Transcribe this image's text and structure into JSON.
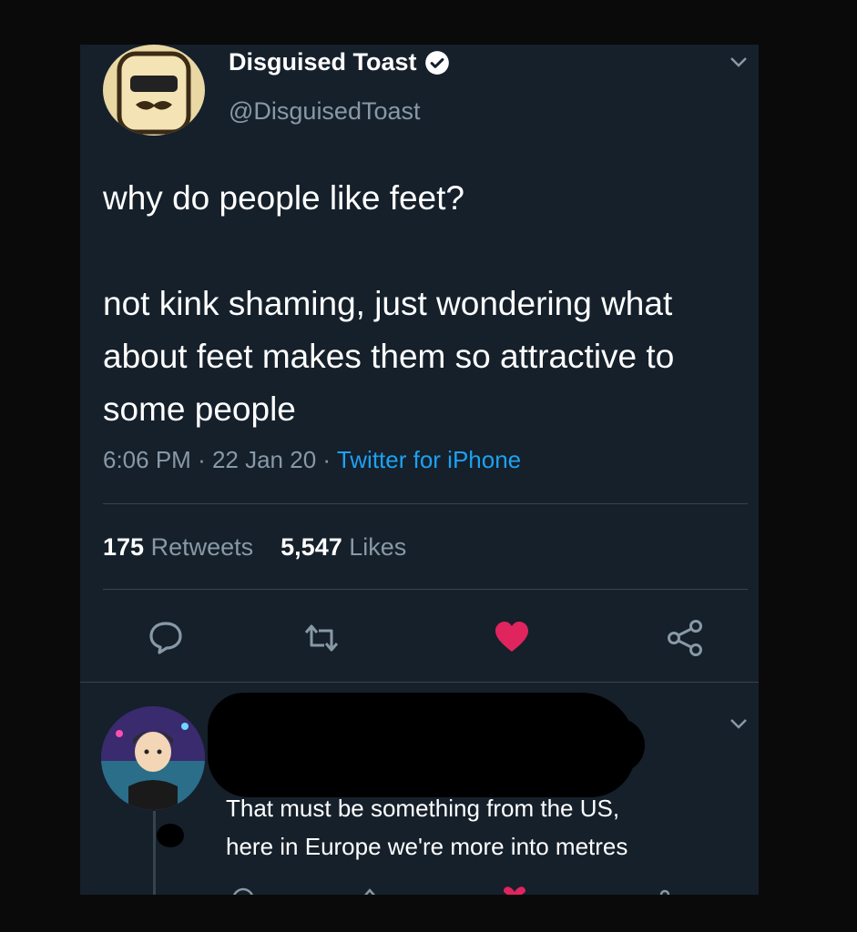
{
  "tweet": {
    "display_name": "Disguised Toast",
    "handle": "@DisguisedToast",
    "verified_icon": "verified-check-icon",
    "text_line1": "why do people like feet?",
    "text_line2": "not kink shaming, just wondering what about feet makes them so attractive to some people",
    "time": "6:06 PM",
    "date": "22 Jan 20",
    "source": "Twitter for iPhone",
    "retweet_count": "175",
    "retweets_label": "Retweets",
    "like_count": "5,547",
    "likes_label": "Likes",
    "actions": [
      "reply-icon",
      "retweet-icon",
      "heart-icon",
      "share-icon"
    ]
  },
  "reply": {
    "text_line1": "That must be something from the US,",
    "text_line2": "here in Europe we're more into metres"
  },
  "colors": {
    "background": "#15202b",
    "accent": "#1da1f2",
    "like": "#e0245e",
    "muted": "#8899a6"
  }
}
